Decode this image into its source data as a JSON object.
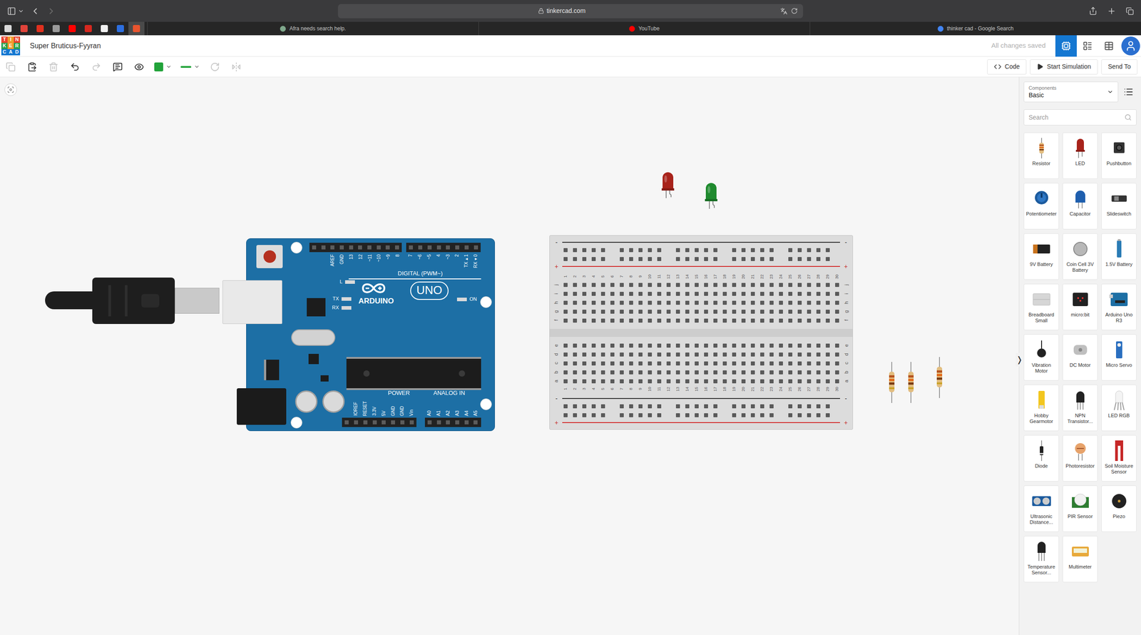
{
  "browser": {
    "url": "tinkercad.com",
    "pinned_tabs": [
      {
        "color": "#d9d9d9",
        "selected": false
      },
      {
        "color": "#e0433a",
        "selected": false
      },
      {
        "color": "#e0301e",
        "selected": false
      },
      {
        "color": "#9a9a9a",
        "selected": false
      },
      {
        "color": "#ff0000",
        "selected": false
      },
      {
        "color": "#d6281f",
        "selected": false
      },
      {
        "color": "#f0f0f0",
        "selected": false
      },
      {
        "color": "#2d6fe0",
        "selected": false
      },
      {
        "color": "#e8542e",
        "selected": true
      }
    ],
    "tabs": [
      {
        "label": "Afra needs search help.",
        "selected": false,
        "color": "#7fa88c"
      },
      {
        "label": "YouTube",
        "selected": false,
        "color": "#ff0000"
      },
      {
        "label": "thinker cad - Google Search",
        "selected": false,
        "color": "#4285f4"
      }
    ]
  },
  "app": {
    "logo": [
      "T",
      "I",
      "N",
      "K",
      "E",
      "R",
      "C",
      "A",
      "D"
    ],
    "title": "Super Bruticus-Fyyran",
    "save_status": "All changes saved",
    "views": [
      {
        "name": "circuit",
        "selected": true
      },
      {
        "name": "schematic",
        "selected": false
      },
      {
        "name": "component-list",
        "selected": false
      }
    ]
  },
  "toolbar": {
    "tools_left": [
      {
        "name": "copy",
        "disabled": true
      },
      {
        "name": "paste",
        "disabled": false
      },
      {
        "name": "delete",
        "disabled": true
      },
      {
        "name": "undo",
        "disabled": false
      },
      {
        "name": "redo",
        "disabled": true
      },
      {
        "name": "notes",
        "disabled": false
      },
      {
        "name": "notes-visibility",
        "disabled": false
      }
    ],
    "color": "#22a33a",
    "tools_right": [
      {
        "name": "rotate",
        "disabled": true
      },
      {
        "name": "flip",
        "disabled": true
      }
    ],
    "buttons": [
      "Code",
      "Start Simulation",
      "Send To"
    ]
  },
  "panel": {
    "label": "Components",
    "value": "Basic",
    "search_placeholder": "Search",
    "expand": "❭",
    "components": [
      {
        "label": "Resistor",
        "kind": "resistor"
      },
      {
        "label": "LED",
        "kind": "led"
      },
      {
        "label": "Pushbutton",
        "kind": "pushbutton"
      },
      {
        "label": "Potentiometer",
        "kind": "potentiometer"
      },
      {
        "label": "Capacitor",
        "kind": "capacitor"
      },
      {
        "label": "Slideswitch",
        "kind": "slideswitch"
      },
      {
        "label": "9V Battery",
        "kind": "battery9v"
      },
      {
        "label": "Coin Cell 3V Battery",
        "kind": "coin"
      },
      {
        "label": "1.5V Battery",
        "kind": "battery15"
      },
      {
        "label": "Breadboard Small",
        "kind": "breadboard"
      },
      {
        "label": "micro:bit",
        "kind": "microbit"
      },
      {
        "label": "Arduino Uno R3",
        "kind": "arduino"
      },
      {
        "label": "Vibration Motor",
        "kind": "vibration"
      },
      {
        "label": "DC Motor",
        "kind": "dcmotor"
      },
      {
        "label": "Micro Servo",
        "kind": "servo"
      },
      {
        "label": "Hobby Gearmotor",
        "kind": "gearmotor"
      },
      {
        "label": "NPN Transistor...",
        "kind": "transistor"
      },
      {
        "label": "LED RGB",
        "kind": "rgb"
      },
      {
        "label": "Diode",
        "kind": "diode"
      },
      {
        "label": "Photoresistor",
        "kind": "photoresistor"
      },
      {
        "label": "Soil Moisture Sensor",
        "kind": "soil"
      },
      {
        "label": "Ultrasonic Distance...",
        "kind": "ultrasonic"
      },
      {
        "label": "PIR Sensor",
        "kind": "pir"
      },
      {
        "label": "Piezo",
        "kind": "piezo"
      },
      {
        "label": "Temperature Sensor...",
        "kind": "temp"
      },
      {
        "label": "Multimeter",
        "kind": "multimeter"
      }
    ]
  },
  "arduino": {
    "digital_pins": [
      "AREF",
      "GND",
      "13",
      "12",
      "~11",
      "~10",
      "~9",
      "8",
      "7",
      "~6",
      "~5",
      "4",
      "~3",
      "2",
      "TX▸1",
      "RX◂0"
    ],
    "digital_label": "DIGITAL (PWM~)",
    "brand": "ARDUINO",
    "model": "UNO",
    "on_label": "ON",
    "leds": [
      "L",
      "TX",
      "RX"
    ],
    "power_label": "POWER",
    "power_pins": [
      "IOREF",
      "RESET",
      "3.3V",
      "5V",
      "GND",
      "GND",
      "Vin"
    ],
    "analog_label": "ANALOG IN",
    "analog_pins": [
      "A0",
      "A1",
      "A2",
      "A3",
      "A4",
      "A5"
    ]
  },
  "breadboard": {
    "columns": [
      "1",
      "2",
      "3",
      "4",
      "5",
      "6",
      "7",
      "8",
      "9",
      "10",
      "11",
      "12",
      "13",
      "14",
      "15",
      "16",
      "17",
      "18",
      "19",
      "20",
      "21",
      "22",
      "23",
      "24",
      "25",
      "26",
      "27",
      "28",
      "29",
      "30"
    ],
    "rows_top": [
      "j",
      "i",
      "h",
      "g",
      "f"
    ],
    "rows_bottom": [
      "e",
      "d",
      "c",
      "b",
      "a"
    ],
    "rail_minus": "-",
    "rail_plus": "+"
  },
  "parts": [
    {
      "kind": "led",
      "color": "#a8231b"
    },
    {
      "kind": "led",
      "color": "#1f8a2e"
    },
    {
      "kind": "resistor"
    },
    {
      "kind": "resistor"
    },
    {
      "kind": "resistor"
    }
  ]
}
